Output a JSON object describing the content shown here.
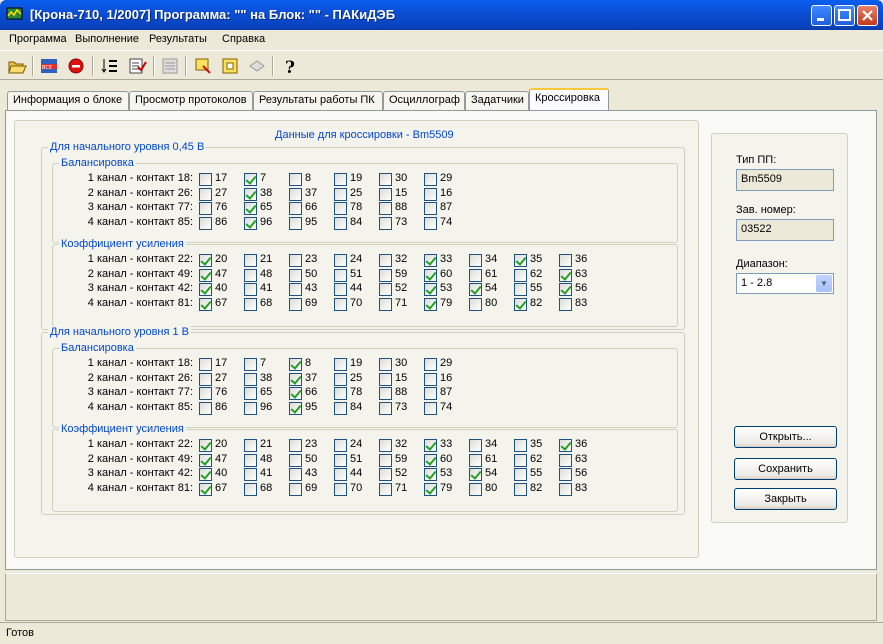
{
  "window": {
    "title": "[Крона-710, 1/2007] Программа: \"\" на Блок: \"\" - ПАКиДЭБ"
  },
  "menu": [
    "Программа",
    "Выполнение",
    "Результаты",
    "Справка"
  ],
  "toolbar_icons": [
    "open-folder-icon",
    "all-icon",
    "stop-icon",
    "sort-icon",
    "checklist-icon",
    "doc-gray-icon",
    "tool-icon",
    "panel-icon",
    "print-gray-icon",
    "help-icon"
  ],
  "tabs": [
    "Информация о блоке",
    "Просмотр протоколов",
    "Результаты работы ПК",
    "Осциллограф",
    "Задатчики",
    "Кроссировка"
  ],
  "main": {
    "title": "Данные для кроссировки - Вm5509",
    "levels": [
      {
        "title": "Для начального уровня 0,45 В",
        "balance": {
          "title": "Балансировка",
          "rows": [
            {
              "label": "1 канал - контакт 18:",
              "cells": [
                {
                  "n": "17",
                  "c": false
                },
                {
                  "n": "7",
                  "c": true
                },
                {
                  "n": "8",
                  "c": false
                },
                {
                  "n": "19",
                  "c": false
                },
                {
                  "n": "30",
                  "c": false
                },
                {
                  "n": "29",
                  "c": false
                }
              ]
            },
            {
              "label": "2 канал - контакт 26:",
              "cells": [
                {
                  "n": "27",
                  "c": false
                },
                {
                  "n": "38",
                  "c": true
                },
                {
                  "n": "37",
                  "c": false
                },
                {
                  "n": "25",
                  "c": false
                },
                {
                  "n": "15",
                  "c": false
                },
                {
                  "n": "16",
                  "c": false
                }
              ]
            },
            {
              "label": "3 канал - контакт 77:",
              "cells": [
                {
                  "n": "76",
                  "c": false
                },
                {
                  "n": "65",
                  "c": true
                },
                {
                  "n": "66",
                  "c": false
                },
                {
                  "n": "78",
                  "c": false
                },
                {
                  "n": "88",
                  "c": false
                },
                {
                  "n": "87",
                  "c": false
                }
              ]
            },
            {
              "label": "4 канал - контакт 85:",
              "cells": [
                {
                  "n": "86",
                  "c": false
                },
                {
                  "n": "96",
                  "c": true
                },
                {
                  "n": "95",
                  "c": false
                },
                {
                  "n": "84",
                  "c": false
                },
                {
                  "n": "73",
                  "c": false
                },
                {
                  "n": "74",
                  "c": false
                }
              ]
            }
          ]
        },
        "gain": {
          "title": "Коэффициент усиления",
          "rows": [
            {
              "label": "1 канал - контакт 22:",
              "cells": [
                {
                  "n": "20",
                  "c": true
                },
                {
                  "n": "21",
                  "c": false
                },
                {
                  "n": "23",
                  "c": false
                },
                {
                  "n": "24",
                  "c": false
                },
                {
                  "n": "32",
                  "c": false
                },
                {
                  "n": "33",
                  "c": true
                },
                {
                  "n": "34",
                  "c": false
                },
                {
                  "n": "35",
                  "c": true
                },
                {
                  "n": "36",
                  "c": false
                }
              ]
            },
            {
              "label": "2 канал - контакт 49:",
              "cells": [
                {
                  "n": "47",
                  "c": true
                },
                {
                  "n": "48",
                  "c": false
                },
                {
                  "n": "50",
                  "c": false
                },
                {
                  "n": "51",
                  "c": false
                },
                {
                  "n": "59",
                  "c": false
                },
                {
                  "n": "60",
                  "c": true
                },
                {
                  "n": "61",
                  "c": false
                },
                {
                  "n": "62",
                  "c": false
                },
                {
                  "n": "63",
                  "c": true
                }
              ]
            },
            {
              "label": "3 канал - контакт 42:",
              "cells": [
                {
                  "n": "40",
                  "c": true
                },
                {
                  "n": "41",
                  "c": false
                },
                {
                  "n": "43",
                  "c": false
                },
                {
                  "n": "44",
                  "c": false
                },
                {
                  "n": "52",
                  "c": false
                },
                {
                  "n": "53",
                  "c": true
                },
                {
                  "n": "54",
                  "c": true
                },
                {
                  "n": "55",
                  "c": false
                },
                {
                  "n": "56",
                  "c": true
                }
              ]
            },
            {
              "label": "4 канал - контакт 81:",
              "cells": [
                {
                  "n": "67",
                  "c": true
                },
                {
                  "n": "68",
                  "c": false
                },
                {
                  "n": "69",
                  "c": false
                },
                {
                  "n": "70",
                  "c": false
                },
                {
                  "n": "71",
                  "c": false
                },
                {
                  "n": "79",
                  "c": true
                },
                {
                  "n": "80",
                  "c": false
                },
                {
                  "n": "82",
                  "c": true
                },
                {
                  "n": "83",
                  "c": false
                }
              ]
            }
          ]
        }
      },
      {
        "title": "Для начального уровня 1 В",
        "balance": {
          "title": "Балансировка",
          "rows": [
            {
              "label": "1 канал - контакт 18:",
              "cells": [
                {
                  "n": "17",
                  "c": false
                },
                {
                  "n": "7",
                  "c": false
                },
                {
                  "n": "8",
                  "c": true
                },
                {
                  "n": "19",
                  "c": false
                },
                {
                  "n": "30",
                  "c": false
                },
                {
                  "n": "29",
                  "c": false
                }
              ]
            },
            {
              "label": "2 канал - контакт 26:",
              "cells": [
                {
                  "n": "27",
                  "c": false
                },
                {
                  "n": "38",
                  "c": false
                },
                {
                  "n": "37",
                  "c": true
                },
                {
                  "n": "25",
                  "c": false
                },
                {
                  "n": "15",
                  "c": false
                },
                {
                  "n": "16",
                  "c": false
                }
              ]
            },
            {
              "label": "3 канал - контакт 77:",
              "cells": [
                {
                  "n": "76",
                  "c": false
                },
                {
                  "n": "65",
                  "c": false
                },
                {
                  "n": "66",
                  "c": true
                },
                {
                  "n": "78",
                  "c": false
                },
                {
                  "n": "88",
                  "c": false
                },
                {
                  "n": "87",
                  "c": false
                }
              ]
            },
            {
              "label": "4 канал - контакт 85:",
              "cells": [
                {
                  "n": "86",
                  "c": false
                },
                {
                  "n": "96",
                  "c": false
                },
                {
                  "n": "95",
                  "c": true
                },
                {
                  "n": "84",
                  "c": false
                },
                {
                  "n": "73",
                  "c": false
                },
                {
                  "n": "74",
                  "c": false
                }
              ]
            }
          ]
        },
        "gain": {
          "title": "Коэффициент усиления",
          "rows": [
            {
              "label": "1 канал - контакт 22:",
              "cells": [
                {
                  "n": "20",
                  "c": true
                },
                {
                  "n": "21",
                  "c": false
                },
                {
                  "n": "23",
                  "c": false
                },
                {
                  "n": "24",
                  "c": false
                },
                {
                  "n": "32",
                  "c": false
                },
                {
                  "n": "33",
                  "c": true
                },
                {
                  "n": "34",
                  "c": false
                },
                {
                  "n": "35",
                  "c": false
                },
                {
                  "n": "36",
                  "c": true
                }
              ]
            },
            {
              "label": "2 канал - контакт 49:",
              "cells": [
                {
                  "n": "47",
                  "c": true
                },
                {
                  "n": "48",
                  "c": false
                },
                {
                  "n": "50",
                  "c": false
                },
                {
                  "n": "51",
                  "c": false
                },
                {
                  "n": "59",
                  "c": false
                },
                {
                  "n": "60",
                  "c": true
                },
                {
                  "n": "61",
                  "c": false
                },
                {
                  "n": "62",
                  "c": false
                },
                {
                  "n": "63",
                  "c": false
                }
              ]
            },
            {
              "label": "3 канал - контакт 42:",
              "cells": [
                {
                  "n": "40",
                  "c": true
                },
                {
                  "n": "41",
                  "c": false
                },
                {
                  "n": "43",
                  "c": false
                },
                {
                  "n": "44",
                  "c": false
                },
                {
                  "n": "52",
                  "c": false
                },
                {
                  "n": "53",
                  "c": true
                },
                {
                  "n": "54",
                  "c": true
                },
                {
                  "n": "55",
                  "c": false
                },
                {
                  "n": "56",
                  "c": false
                }
              ]
            },
            {
              "label": "4 канал - контакт 81:",
              "cells": [
                {
                  "n": "67",
                  "c": true
                },
                {
                  "n": "68",
                  "c": false
                },
                {
                  "n": "69",
                  "c": false
                },
                {
                  "n": "70",
                  "c": false
                },
                {
                  "n": "71",
                  "c": false
                },
                {
                  "n": "79",
                  "c": true
                },
                {
                  "n": "80",
                  "c": false
                },
                {
                  "n": "82",
                  "c": false
                },
                {
                  "n": "83",
                  "c": false
                }
              ]
            }
          ]
        }
      }
    ]
  },
  "side": {
    "type_label": "Тип ПП:",
    "type_value": "Вm5509",
    "serial_label": "Зав. номер:",
    "serial_value": "03522",
    "range_label": "Диапазон:",
    "range_value": "1 - 2.8",
    "open_button": "Открыть...",
    "save_button": "Сохранить",
    "close_button": "Закрыть"
  },
  "status": {
    "text": "Готов"
  }
}
